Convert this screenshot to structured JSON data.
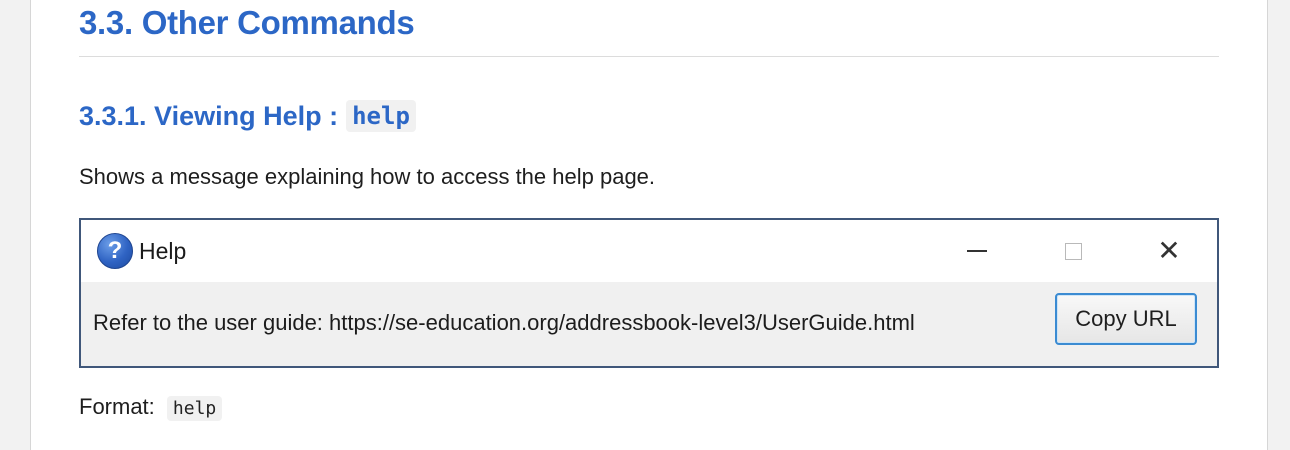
{
  "section": {
    "heading": "3.3. Other Commands"
  },
  "subsection": {
    "heading": "3.3.1. Viewing Help :",
    "command": "help",
    "description": "Shows a message explaining how to access the help page."
  },
  "help_window": {
    "title": "Help",
    "title_icon": "question-mark-icon",
    "message": "Refer to the user guide: https://se-education.org/addressbook-level3/UserGuide.html",
    "copy_button_label": "Copy URL",
    "controls": {
      "minimize_icon": "minimize-icon",
      "maximize_icon": "maximize-icon",
      "close_icon": "close-icon"
    },
    "colors": {
      "border": "#40577a",
      "button_focus": "#3b8bd2"
    }
  },
  "format": {
    "label": "Format:",
    "command": "help"
  },
  "colors": {
    "heading": "#2c67c6"
  }
}
